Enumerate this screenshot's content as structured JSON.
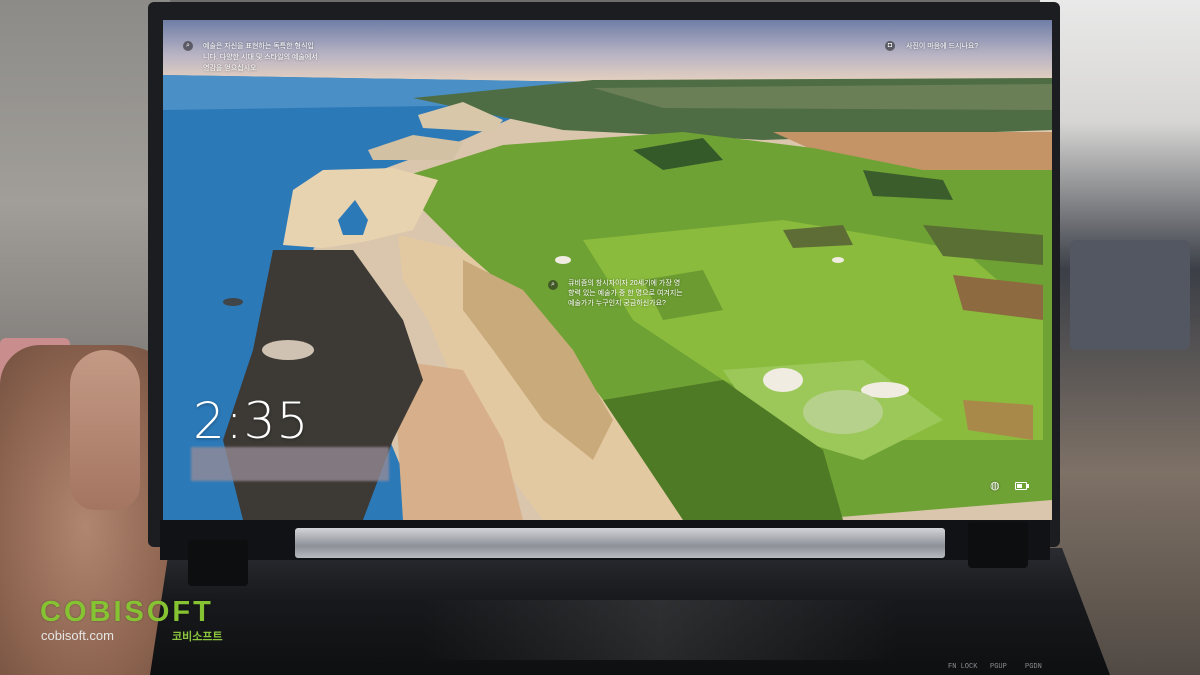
{
  "lockscreen": {
    "headline": "예술은 자신을 표현하는 독특한 형식입니다. 다양한 시대 및 스타일의 예술에서 영감을 얻으십시오.",
    "headline_lines": [
      "예술은 자신을 표현하는 독특한 형식입",
      "니다. 다양한 시대 및 스타일의 예술에서",
      "영감을 얻으십시오."
    ],
    "feedback_prompt": "사진이 마음에 드시나요?",
    "hotspot_lines": [
      "큐비즘의 창시자이자 20세기에 가장 영",
      "향력 있는 예술가 중 한 명으로 여겨지는",
      "예술가가 누구인지 궁금하신가요?"
    ],
    "time": "2:35",
    "icons": {
      "search": "search-icon",
      "camera": "camera-icon",
      "hotspot": "search-icon",
      "network": "globe-icon",
      "battery": "battery-icon"
    }
  },
  "watermark": {
    "brand": "COBISOFT",
    "url": "cobisoft.com",
    "korean": "코비소프트"
  },
  "device": {
    "key_labels": [
      "FN LOCK",
      "PGUP",
      "PGDN"
    ]
  },
  "colors": {
    "brand_green": "#86c332",
    "sea": "#2c79b8",
    "grass": "#6fa234",
    "cliff": "#e8d3b0"
  }
}
